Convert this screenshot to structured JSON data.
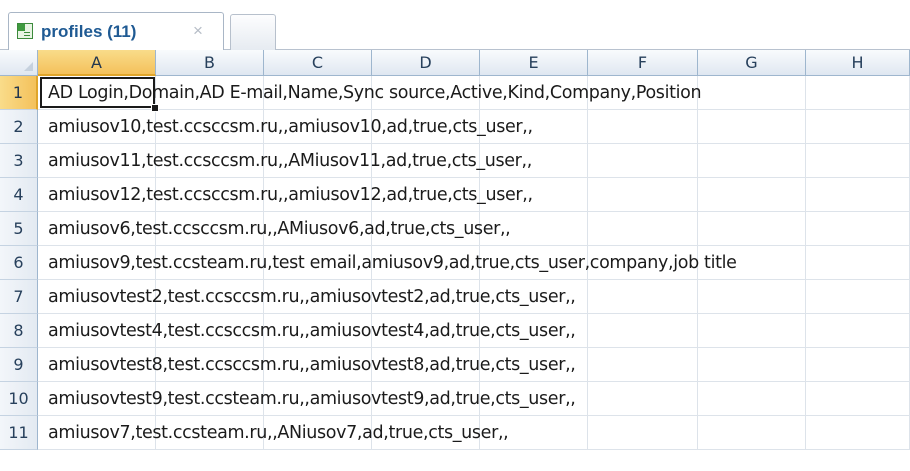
{
  "tab": {
    "title": "profiles (11)",
    "close": "×"
  },
  "columns": [
    "A",
    "B",
    "C",
    "D",
    "E",
    "F",
    "G",
    "H"
  ],
  "rows": [
    {
      "num": "1",
      "text": "AD Login,Domain,AD E-mail,Name,Sync source,Active,Kind,Company,Position"
    },
    {
      "num": "2",
      "text": "amiusov10,test.ccsccsm.ru,,amiusov10,ad,true,cts_user,,"
    },
    {
      "num": "3",
      "text": "amiusov11,test.ccsccsm.ru,,AMiusov11,ad,true,cts_user,,"
    },
    {
      "num": "4",
      "text": "amiusov12,test.ccsccsm.ru,,amiusov12,ad,true,cts_user,,"
    },
    {
      "num": "5",
      "text": "amiusov6,test.ccsccsm.ru,,AMiusov6,ad,true,cts_user,,"
    },
    {
      "num": "6",
      "text": "amiusov9,test.ccsteam.ru,test email,amiusov9,ad,true,cts_user,company,job title"
    },
    {
      "num": "7",
      "text": "amiusovtest2,test.ccsccsm.ru,,amiusovtest2,ad,true,cts_user,,"
    },
    {
      "num": "8",
      "text": "amiusovtest4,test.ccsccsm.ru,,amiusovtest4,ad,true,cts_user,,"
    },
    {
      "num": "9",
      "text": "amiusovtest8,test.ccsccsm.ru,,amiusovtest8,ad,true,cts_user,,"
    },
    {
      "num": "10",
      "text": "amiusovtest9,test.ccsteam.ru,,amiusovtest9,ad,true,cts_user,,"
    },
    {
      "num": "11",
      "text": "amiusov7,test.ccsteam.ru,,ANiusov7,ad,true,cts_user,,"
    }
  ],
  "selected": {
    "column": "A",
    "row": "1"
  }
}
